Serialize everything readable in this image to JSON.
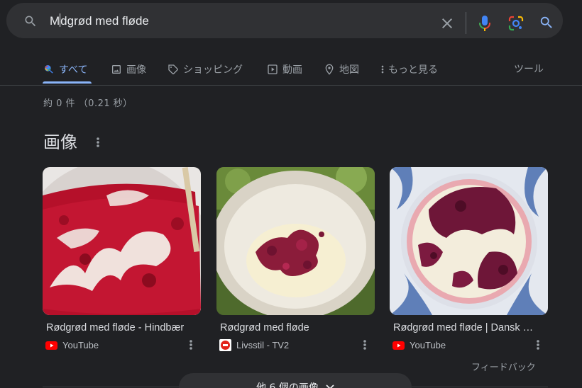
{
  "search": {
    "query_before_caret": "M",
    "query_after_caret": "dgrød med fløde",
    "icons": [
      "search-icon",
      "clear-icon",
      "microphone-icon",
      "camera-lens-icon",
      "search-submit-icon"
    ]
  },
  "tabs": [
    {
      "label": "すべて",
      "icon": "google-search-icon",
      "active": true
    },
    {
      "label": "画像",
      "icon": "image-icon"
    },
    {
      "label": "ショッピング",
      "icon": "tag-icon"
    },
    {
      "label": "動画",
      "icon": "play-icon"
    },
    {
      "label": "地図",
      "icon": "map-pin-icon"
    },
    {
      "label": "もっと見る",
      "icon": "more-vert-icon"
    }
  ],
  "tools_label": "ツール",
  "result_stats": "約 0 件 （0.21 秒）",
  "images_section": {
    "title": "画像",
    "cards": [
      {
        "title": "Rødgrød med fløde - Hindbær",
        "source": "YouTube",
        "source_icon": "youtube-icon"
      },
      {
        "title": "Rødgrød med fløde",
        "source": "Livsstil - TV2",
        "source_icon": "tv2-icon"
      },
      {
        "title": "Rødgrød med fløde | Dansk opskrift",
        "source": "YouTube",
        "source_icon": "youtube-icon"
      }
    ],
    "feedback": "フィードバック",
    "more_button": "他 6 個の画像"
  },
  "colors": {
    "background": "#202124",
    "search_bar": "#303134",
    "accent": "#8ab4f8",
    "youtube_red": "#ff0000"
  }
}
